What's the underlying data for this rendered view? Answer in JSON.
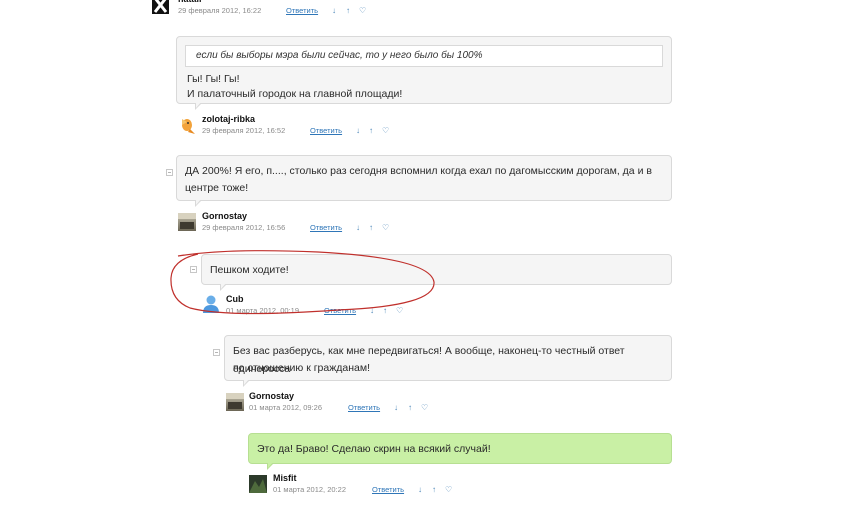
{
  "comments": [
    {
      "author": "natali",
      "date": "29 февраля 2012, 16:22",
      "reply_label": "Ответить"
    },
    {
      "quote": "если бы выборы мэра были сейчас, то у него было бы 100%",
      "lines": [
        "Гы! Гы! Гы!",
        "И палаточный городок на главной площади!"
      ],
      "author": "zolotaj-ribka",
      "date": "29 февраля 2012, 16:52",
      "reply_label": "Ответить"
    },
    {
      "lines": [
        "ДА 200%! Я его, п...., столько раз сегодня вспомнил когда ехал по дагомысским дорогам, да и в",
        "центре тоже!"
      ],
      "author": "Gornostay",
      "date": "29 февраля 2012, 16:56",
      "reply_label": "Ответить"
    },
    {
      "lines": [
        "Пешком ходите!"
      ],
      "author": "Cub",
      "date": "01 марта 2012, 00:19",
      "reply_label": "Ответить"
    },
    {
      "lines": [
        "Без вас разберусь, как мне передвигаться! А вообще, наконец-то честный ответ единоросса",
        "по отношению к гражданам!"
      ],
      "author": "Gornostay",
      "date": "01 марта 2012, 09:26",
      "reply_label": "Ответить"
    },
    {
      "lines": [
        "Это да! Браво! Сделаю скрин на всякий случай!"
      ],
      "author": "Misfit",
      "date": "01 марта 2012, 20:22",
      "reply_label": "Ответить"
    }
  ],
  "icons": {
    "down": "↓",
    "up": "↑",
    "fav": "♡"
  },
  "colors": {
    "link": "#2f76b8",
    "bubble": "#f5f5f5",
    "highlight_bubble": "#c9f0a5",
    "annotation": "#c0302c"
  }
}
